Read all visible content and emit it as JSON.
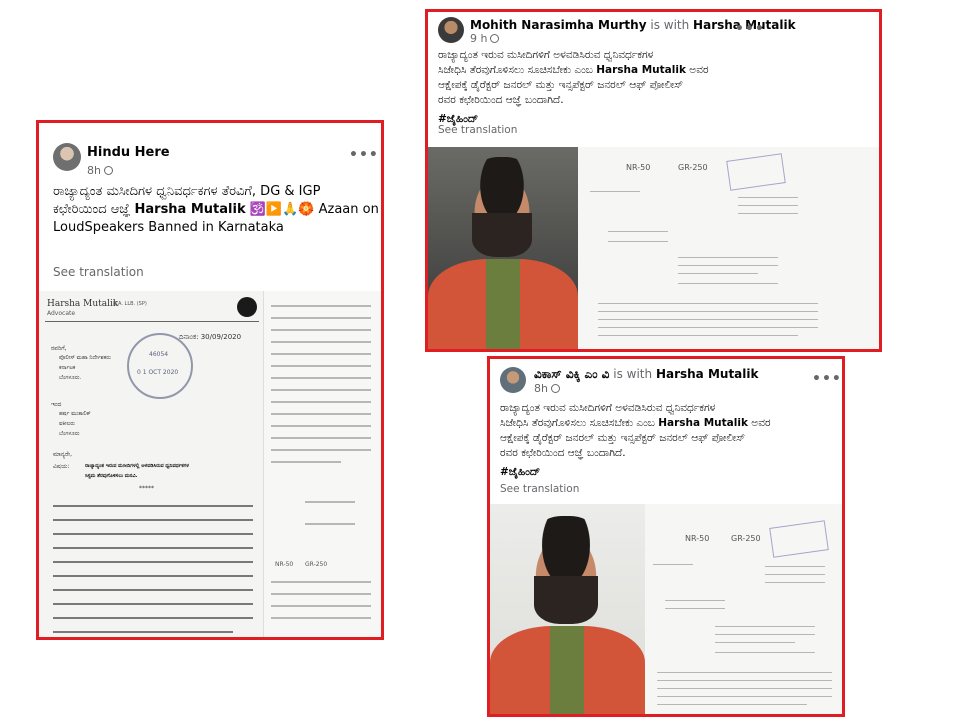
{
  "post_left": {
    "author": "Hindu Here",
    "time": "8h",
    "more": "•••",
    "text_line1": "ರಾಜ್ಯಾದ್ಯಂತ ಮಸೀದಿಗಳ ಧ್ವನಿವರ್ಧಕಗಳ ತೆರವಿಗೆ, DG & IGP",
    "text_line2_a": "ಕಛೇರಿಯಿಂದ ಆಜ್ಞೆ ",
    "text_line2_b": "Harsha Mutalik",
    "text_line2_c": " 🕉️▶️🙏🏵️ Azaan on",
    "text_line3": "LoudSpeakers Banned in Karnataka",
    "see_translation": "See translation",
    "doc": {
      "letterhead": "Harsha Mutalik",
      "letterhead_sub": "B.A. LLB. (SP)",
      "role": "Advocate",
      "date": "ದಿನಾಂಕ: 30/09/2020",
      "to_label": "ರವರಿಗೆ,",
      "to1": "ಪೊಲೀಸ್ ಮಹಾ ನಿರ್ದೇಶಕರು",
      "to2": "ಕರ್ನಾಟಕ",
      "to3": "ಬೆಂಗಳೂರು.",
      "via_label": "ಇಂದ",
      "from1": "ಹರ್ಷ ಮುತಾಲಿಕ್",
      "from2": "ವಕೀಲರು",
      "from3": "ಬೆಂಗಳೂರು",
      "salutation": "ಮಾನ್ಯರೇ,",
      "subject_label": "ವಿಷಯ:",
      "subject1": "ರಾಜ್ಯಾದ್ಯಂತ ಇರುವ ಮಸೀದಿಗಳಲ್ಲಿ ಅಳವಡಿಸಿರುವ ಧ್ವನಿವರ್ಧಕಗಳ",
      "subject2": "ಸಿಸ್ಟಮ ತೆರವುಗೊಳಿಸಲು ಮನವಿ.",
      "stars": "*****",
      "stamp_date": "0 1 OCT 2020",
      "stamp_num": "46054"
    }
  },
  "post_top_right": {
    "author": "Mohith Narasimha Murthy",
    "with": " is with ",
    "with_name": "Harsha Mutalik",
    "time": "9 h",
    "more": "•••",
    "text_line1": "ರಾಜ್ಯಾದ್ಯಂತ ಇರುವ ಮಸೀದಿಗಳಿಗೆ ಅಳವಡಿಸಿರುವ ಧ್ವನಿವರ್ಧಕಗಳ",
    "text_line2_a": "ಸಿಜೇಧಿಸಿ ತೆರವುಗೊಳಿಸಲು ಸೂಚಿಸಬೇಕು ಎಂಬ ",
    "text_line2_b": "Harsha Mutalik",
    "text_line2_c": " ಅವರ",
    "text_line3": "ಆಕ್ಷೇಪಕ್ಕೆ ಡೈರೆಕ್ಟರ್ ಜನರಲ್ ಮತ್ತು ಇನ್ಸಪೆಕ್ಟರ್ ಜನರಲ್ ಆಫ್ ಪೋಲೀಸ್",
    "text_line4": "ರವರ ಕಛೇರಿಯಿಂದ ಆಜ್ಞೆ ಬಂದಾಗಿದೆ.",
    "hashtag": "#ಜೈಹಿಂದ್",
    "see_translation": "See translation",
    "doc_codes": [
      "NR-50",
      "GR-250"
    ]
  },
  "post_bottom_right": {
    "author": "ವಿಕಾಸ್ ವಿಕ್ಕಿ ಎಂ ವಿ",
    "with": " is with ",
    "with_name": "Harsha Mutalik",
    "time": "8h",
    "more": "•••",
    "text_line1": "ರಾಜ್ಯಾದ್ಯಂತ ಇರುವ ಮಸೀದಿಗಳಿಗೆ ಅಳವಡಿಸಿರುವ ಧ್ವನಿವರ್ಧಕಗಳ",
    "text_line2_a": "ಸಿಜೇಧಿಸಿ ತೆರವುಗೊಳಿಸಲು ಸೂಚಿಸಬೇಕು ಎಂಬ ",
    "text_line2_b": "Harsha Mutalik",
    "text_line2_c": " ಅವರ",
    "text_line3": "ಆಕ್ಷೇಪಕ್ಕೆ ಡೈರೆಕ್ಟರ್ ಜನರಲ್ ಮತ್ತು ಇನ್ಸಪೆಕ್ಟರ್ ಜನರಲ್ ಆಫ್ ಪೋಲೀಸ್",
    "text_line4": "ರವರ ಕಛೇರಿಯಿಂದ ಆಜ್ಞೆ ಬಂದಾಗಿದೆ.",
    "hashtag": "#ಜೈಹಿಂದ್",
    "see_translation": "See translation",
    "doc_codes": [
      "NR-50",
      "GR-250"
    ]
  },
  "colors": {
    "highlight_border": "#e11d24",
    "vest": "#d2553a",
    "muted_text": "#65676b"
  }
}
